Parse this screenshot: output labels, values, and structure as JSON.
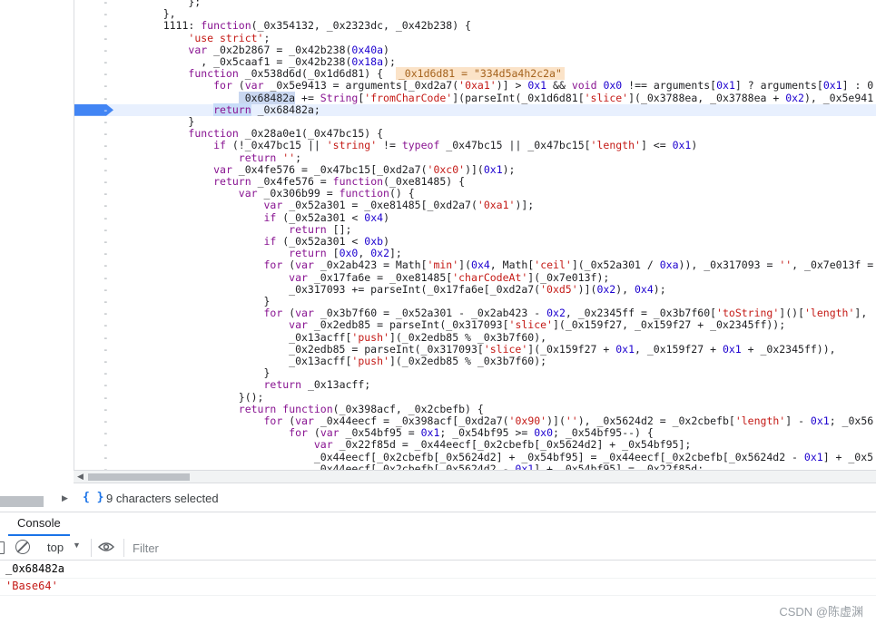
{
  "editor": {
    "lines": [
      {
        "text": "        };",
        "marker": "-"
      },
      {
        "text": "    },",
        "marker": "-"
      },
      {
        "text": "    1111: function(_0x354132, _0x2323dc, _0x42b238) {",
        "marker": "-"
      },
      {
        "text": "        'use strict';",
        "marker": "-"
      },
      {
        "text": "        var _0x2b2867 = _0x42b238(0x40a)",
        "marker": "-"
      },
      {
        "text": "          , _0x5caaf1 = _0x42b238(0x18a);",
        "marker": "-"
      },
      {
        "text": "        function _0x538d6d(_0x1d6d81) {  ",
        "marker": "-",
        "inline_value": "_0x1d6d81 = \"334d5a4h2c2a\""
      },
      {
        "text": "            for (var _0x5e9413 = arguments[_0xd2a7('0xa1')] > 0x1 && void 0x0 !== arguments[0x1] ? arguments[0x1] : 0",
        "marker": "-"
      },
      {
        "text": "                _0x68482a += String['fromCharCode'](parseInt(_0x1d6d81['slice'](_0x3788ea, _0x3788ea + 0x2), _0x5e941",
        "marker": "-"
      },
      {
        "text": "            return _0x68482a;",
        "marker": "-",
        "active": true
      },
      {
        "text": "        }",
        "marker": "-"
      },
      {
        "text": "        function _0x28a0e1(_0x47bc15) {",
        "marker": "-"
      },
      {
        "text": "            if (!_0x47bc15 || 'string' != typeof _0x47bc15 || _0x47bc15['length'] <= 0x1)",
        "marker": "-"
      },
      {
        "text": "                return '';",
        "marker": "-"
      },
      {
        "text": "            var _0x4fe576 = _0x47bc15[_0xd2a7('0xc0')](0x1);",
        "marker": "-"
      },
      {
        "text": "            return _0x4fe576 = function(_0xe81485) {",
        "marker": "-"
      },
      {
        "text": "                var _0x306b99 = function() {",
        "marker": "-"
      },
      {
        "text": "                    var _0x52a301 = _0xe81485[_0xd2a7('0xa1')];",
        "marker": "-"
      },
      {
        "text": "                    if (_0x52a301 < 0x4)",
        "marker": "-"
      },
      {
        "text": "                        return [];",
        "marker": "-"
      },
      {
        "text": "                    if (_0x52a301 < 0xb)",
        "marker": "-"
      },
      {
        "text": "                        return [0x0, 0x2];",
        "marker": "-"
      },
      {
        "text": "                    for (var _0x2ab423 = Math['min'](0x4, Math['ceil'](_0x52a301 / 0xa)), _0x317093 = '', _0x7e013f =",
        "marker": "-"
      },
      {
        "text": "                        var _0x17fa6e = _0xe81485['charCodeAt'](_0x7e013f);",
        "marker": "-"
      },
      {
        "text": "                        _0x317093 += parseInt(_0x17fa6e[_0xd2a7('0xd5')](0x2), 0x4);",
        "marker": "-"
      },
      {
        "text": "                    }",
        "marker": "-"
      },
      {
        "text": "                    for (var _0x3b7f60 = _0x52a301 - _0x2ab423 - 0x2, _0x2345ff = _0x3b7f60['toString']()['length'],",
        "marker": "-"
      },
      {
        "text": "                        var _0x2edb85 = parseInt(_0x317093['slice'](_0x159f27, _0x159f27 + _0x2345ff));",
        "marker": "-"
      },
      {
        "text": "                        _0x13acff['push'](_0x2edb85 % _0x3b7f60),",
        "marker": "-"
      },
      {
        "text": "                        _0x2edb85 = parseInt(_0x317093['slice'](_0x159f27 + 0x1, _0x159f27 + 0x1 + _0x2345ff)),",
        "marker": "-"
      },
      {
        "text": "                        _0x13acff['push'](_0x2edb85 % _0x3b7f60);",
        "marker": "-"
      },
      {
        "text": "                    }",
        "marker": "-"
      },
      {
        "text": "                    return _0x13acff;",
        "marker": "-"
      },
      {
        "text": "                }();",
        "marker": "-"
      },
      {
        "text": "                return function(_0x398acf, _0x2cbefb) {",
        "marker": "-"
      },
      {
        "text": "                    for (var _0x44eecf = _0x398acf[_0xd2a7('0x90')](''), _0x5624d2 = _0x2cbefb['length'] - 0x1; _0x56",
        "marker": "-"
      },
      {
        "text": "                        for (var _0x54bf95 = 0x1; _0x54bf95 >= 0x0; _0x54bf95--) {",
        "marker": "-"
      },
      {
        "text": "                            var _0x22f85d = _0x44eecf[_0x2cbefb[_0x5624d2] + _0x54bf95];",
        "marker": "-"
      },
      {
        "text": "                            _0x44eecf[_0x2cbefb[_0x5624d2] + _0x54bf95] = _0x44eecf[_0x2cbefb[_0x5624d2 - 0x1] + _0x5",
        "marker": "-"
      },
      {
        "text": "                            _0x44eecf[_0x2cbefb[_0x5624d2 - 0x1] + _0x54bf95] = _0x22f85d;",
        "marker": "-"
      }
    ]
  },
  "status": {
    "braces_icon": "{ }",
    "selection": "9 characters selected"
  },
  "drawer": {
    "tab_console": "Console"
  },
  "toolbar": {
    "context": "top",
    "filter_placeholder": "Filter"
  },
  "console": {
    "input": "_0x68482a",
    "output": "'Base64'"
  },
  "watermark": "CSDN @陈虚渊",
  "colors": {
    "keyword": "#881391",
    "string": "#c41a16",
    "number": "#1c00cf",
    "breakpoint": "#4285f4",
    "active_line": "#e8f0fe"
  }
}
